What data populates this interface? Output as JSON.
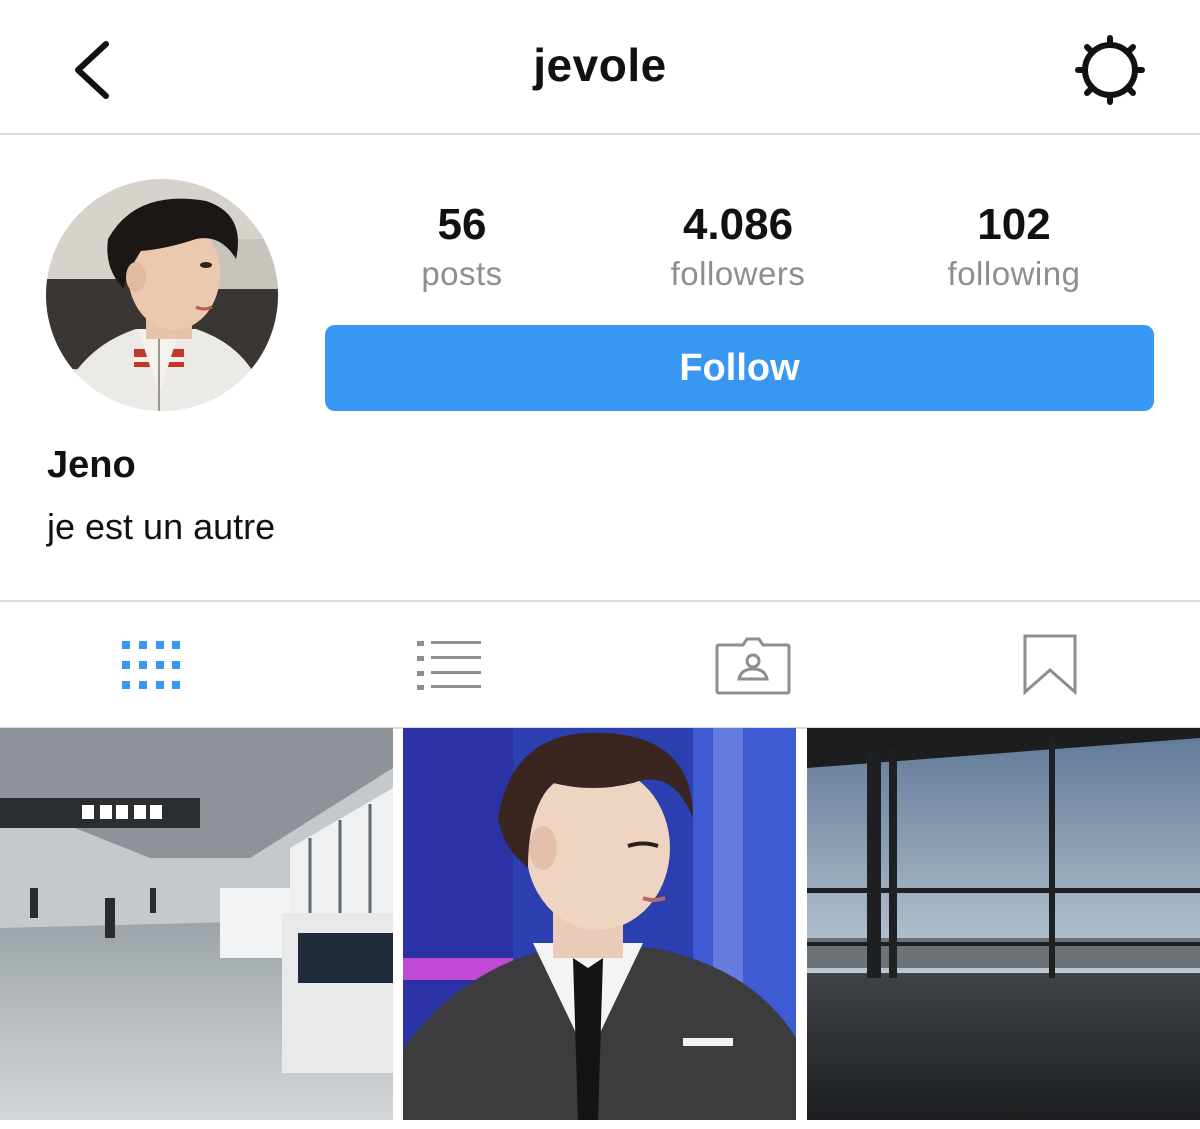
{
  "header": {
    "username": "jevole",
    "back_icon": "chevron-left-icon",
    "settings_icon": "gear-icon"
  },
  "profile": {
    "stats": [
      {
        "value": "56",
        "label": "posts"
      },
      {
        "value": "4.086",
        "label": "followers"
      },
      {
        "value": "102",
        "label": "following"
      }
    ],
    "follow_label": "Follow",
    "full_name": "Jeno",
    "bio": "je est un autre"
  },
  "tabs": [
    {
      "icon": "grid-icon",
      "active": true
    },
    {
      "icon": "list-icon",
      "active": false
    },
    {
      "icon": "tagged-icon",
      "active": false
    },
    {
      "icon": "bookmark-icon",
      "active": false
    }
  ],
  "colors": {
    "accent": "#3897f0",
    "inactive_icon": "#8e8e8e",
    "divider": "#dbdbdb"
  },
  "posts": [
    {
      "description": "airport-terminal-photo"
    },
    {
      "description": "portrait-suit-photo"
    },
    {
      "description": "airport-window-photo"
    }
  ]
}
